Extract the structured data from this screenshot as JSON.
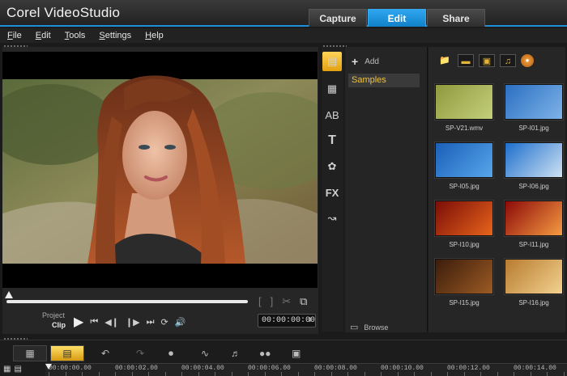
{
  "app": {
    "title": "Corel VideoStudio"
  },
  "tabs": [
    {
      "label": "Capture",
      "active": false
    },
    {
      "label": "Edit",
      "active": true
    },
    {
      "label": "Share",
      "active": false
    }
  ],
  "menu": [
    {
      "label": "File",
      "key": "F",
      "rest": "ile"
    },
    {
      "label": "Edit",
      "key": "E",
      "rest": "dit"
    },
    {
      "label": "Tools",
      "key": "T",
      "rest": "ools"
    },
    {
      "label": "Settings",
      "key": "S",
      "rest": "ettings"
    },
    {
      "label": "Help",
      "key": "H",
      "rest": "elp"
    }
  ],
  "preview": {
    "mode_project": "Project",
    "mode_clip": "Clip",
    "timecode": "00:00:00:00",
    "playhead_fraction": 0
  },
  "library": {
    "add_label": "Add",
    "folder": "Samples",
    "browse_label": "Browse",
    "items": [
      {
        "name": "SP-V21.wmv",
        "colors": [
          "#8f9a3e",
          "#c4cf7b"
        ]
      },
      {
        "name": "SP-I01.jpg",
        "colors": [
          "#2a6fc2",
          "#7fb3e8"
        ]
      },
      {
        "name": "SP-I05.jpg",
        "colors": [
          "#1a5fb8",
          "#58a6ea"
        ]
      },
      {
        "name": "SP-I06.jpg",
        "colors": [
          "#1d6fcc",
          "#cfe1f3"
        ]
      },
      {
        "name": "SP-I10.jpg",
        "colors": [
          "#7a0d08",
          "#e8641b"
        ]
      },
      {
        "name": "SP-I11.jpg",
        "colors": [
          "#8c0a09",
          "#f59b42"
        ]
      },
      {
        "name": "SP-I15.jpg",
        "colors": [
          "#3b1d0c",
          "#9c5a24"
        ]
      },
      {
        "name": "SP-I16.jpg",
        "colors": [
          "#b77b30",
          "#f3d28f"
        ]
      }
    ]
  },
  "timeline": {
    "ruler": [
      "00:00:00.00",
      "00:00:02.00",
      "00:00:04.00",
      "00:00:06.00",
      "00:00:08.00",
      "00:00:10.00",
      "00:00:12.00",
      "00:00:14.00"
    ]
  },
  "colors": {
    "accent": "#1e8fd9",
    "folder_text": "#f0c23a"
  }
}
